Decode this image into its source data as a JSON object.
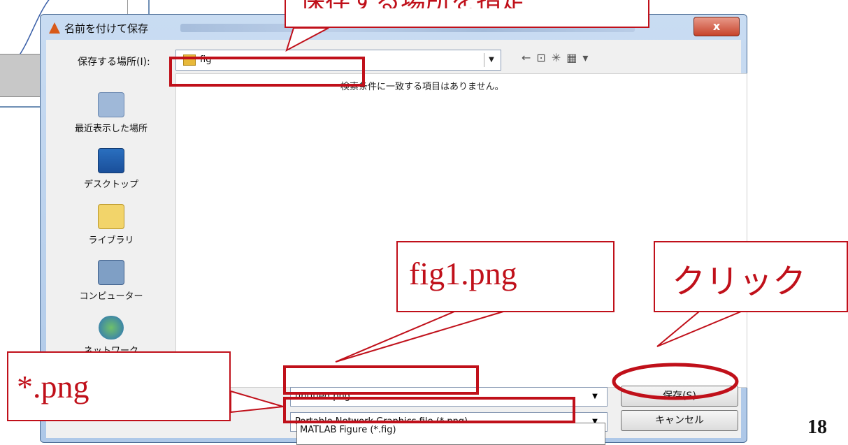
{
  "dialog": {
    "title": "名前を付けて保存",
    "close_label": "x",
    "save_in_label": "保存する場所(I):",
    "save_in_value": "fig",
    "empty_message": "検索条件に一致する項目はありません。",
    "places": [
      {
        "label": "最近表示した場所",
        "icon": "recent-places-icon"
      },
      {
        "label": "デスクトップ",
        "icon": "desktop-icon"
      },
      {
        "label": "ライブラリ",
        "icon": "library-icon"
      },
      {
        "label": "コンピューター",
        "icon": "computer-icon"
      },
      {
        "label": "ネットワーク",
        "icon": "network-icon"
      }
    ],
    "filename_label": "):",
    "filename_value": "untitled.png",
    "filetype_value": "Portable Network Graphics file (*.png)",
    "filetype_option": "MATLAB Figure (*.fig)",
    "save_button": "保存(S)",
    "cancel_button": "キャンセル"
  },
  "annotations": {
    "top_callout": "保存する場所を指定",
    "filename_callout": "fig1.png",
    "click_callout": "クリック",
    "filetype_callout": "*.png",
    "highlight_color": "#c0101a"
  },
  "slide": {
    "page_number": "18"
  }
}
